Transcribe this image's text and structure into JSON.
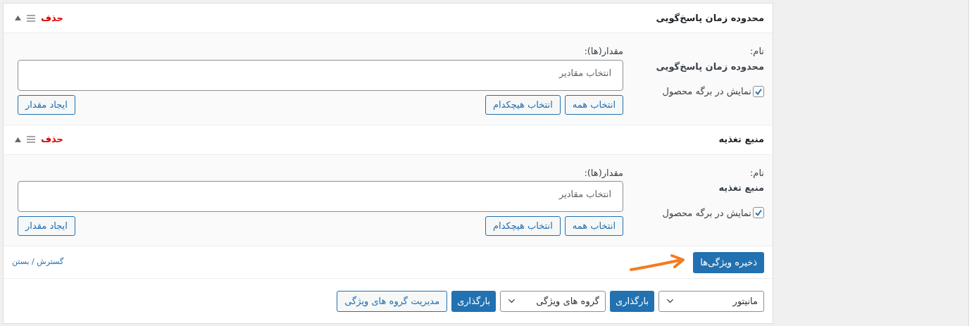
{
  "attributes": [
    {
      "title": "محدوده زمان پاسخ‌گویی",
      "delete": "حذف",
      "name_label": "نام:",
      "name": "محدوده زمان پاسخ‌گویی",
      "values_label": "مقدار(ها):",
      "values_placeholder": "انتخاب مقادیر",
      "visible_label": "نمایش در برگه محصول",
      "visible_checked": true,
      "select_all": "انتخاب همه",
      "select_none": "انتخاب هیچکدام",
      "add_value": "ایجاد مقدار"
    },
    {
      "title": "منبع تغذیه",
      "delete": "حذف",
      "name_label": "نام:",
      "name": "منبع تغذیه",
      "values_label": "مقدار(ها):",
      "values_placeholder": "انتخاب مقادیر",
      "visible_label": "نمایش در برگه محصول",
      "visible_checked": true,
      "select_all": "انتخاب همه",
      "select_none": "انتخاب هیچکدام",
      "add_value": "ایجاد مقدار"
    }
  ],
  "save_button": "ذخیره ویژگی‌ها",
  "expand_collapse": "گسترش / بستن",
  "toolbar": [
    {
      "kind": "select",
      "value": "مانیتور"
    },
    {
      "kind": "primary",
      "label": "بارگذاری"
    },
    {
      "kind": "select",
      "value": "گروه های ویژگی"
    },
    {
      "kind": "primary",
      "label": "بارگذاری"
    },
    {
      "kind": "secondary",
      "label": "مدیریت گروه های ویژگی"
    }
  ]
}
